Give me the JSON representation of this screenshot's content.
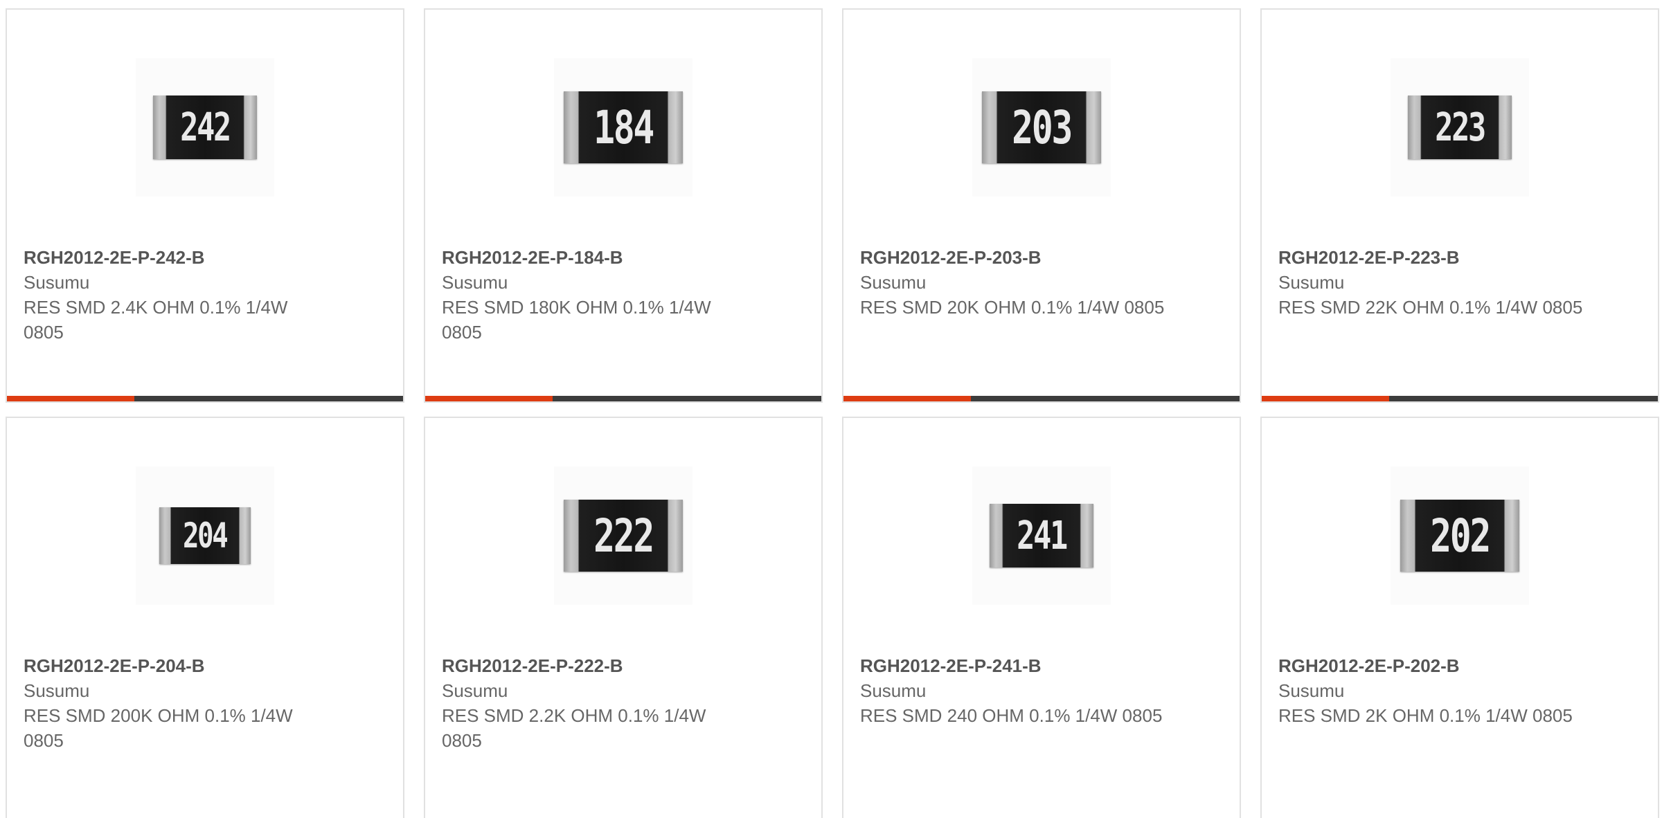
{
  "products": [
    {
      "part": "RGH2012-2E-P-242-B",
      "manufacturer": "Susumu",
      "description": "RES SMD 2.4K OHM 0.1% 1/4W 0805",
      "marking": "242"
    },
    {
      "part": "RGH2012-2E-P-184-B",
      "manufacturer": "Susumu",
      "description": "RES SMD 180K OHM 0.1% 1/4W 0805",
      "marking": "184"
    },
    {
      "part": "RGH2012-2E-P-203-B",
      "manufacturer": "Susumu",
      "description": "RES SMD 20K OHM 0.1% 1/4W 0805",
      "marking": "203"
    },
    {
      "part": "RGH2012-2E-P-223-B",
      "manufacturer": "Susumu",
      "description": "RES SMD 22K OHM 0.1% 1/4W 0805",
      "marking": "223"
    },
    {
      "part": "RGH2012-2E-P-204-B",
      "manufacturer": "Susumu",
      "description": "RES SMD 200K OHM 0.1% 1/4W 0805",
      "marking": "204"
    },
    {
      "part": "RGH2012-2E-P-222-B",
      "manufacturer": "Susumu",
      "description": "RES SMD 2.2K OHM 0.1% 1/4W 0805",
      "marking": "222"
    },
    {
      "part": "RGH2012-2E-P-241-B",
      "manufacturer": "Susumu",
      "description": "RES SMD 240 OHM 0.1% 1/4W 0805",
      "marking": "241"
    },
    {
      "part": "RGH2012-2E-P-202-B",
      "manufacturer": "Susumu",
      "description": "RES SMD 2K OHM 0.1% 1/4W 0805",
      "marking": "202"
    }
  ],
  "colors": {
    "accent": "#de3c12",
    "bar": "#3c3c3c",
    "border": "#e1e1e1",
    "text": "#666666"
  }
}
